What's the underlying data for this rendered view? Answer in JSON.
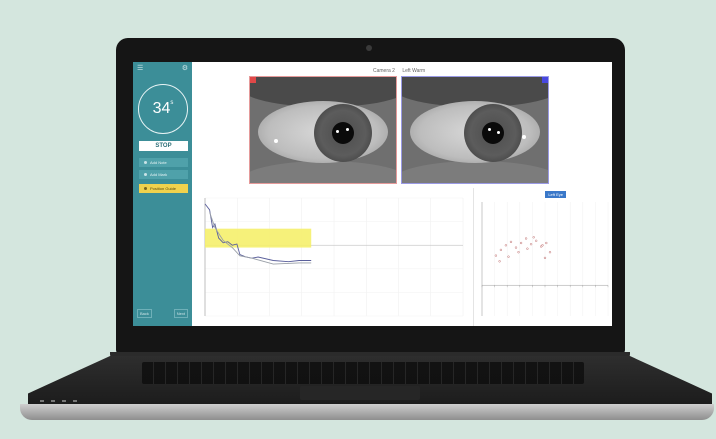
{
  "timer": {
    "value": "34",
    "unit": "s"
  },
  "sidebar": {
    "stop_label": "STOP",
    "buttons": [
      {
        "label": "Add Note",
        "active": false
      },
      {
        "label": "Add Mark",
        "active": false
      },
      {
        "label": "Position Guide",
        "active": true
      }
    ],
    "footer_left": "Back",
    "footer_right": "Next",
    "accent_color": "#3c8e98",
    "highlight_color": "#f0d24d"
  },
  "camera": {
    "camera_label": "Camera 2",
    "eye_label": "Left Warm"
  },
  "main_chart": {
    "title": "",
    "highlight_color": "#f5ef6b"
  },
  "scatter_chart": {
    "badge": "Left Eye",
    "corner_label": ""
  },
  "chart_data": [
    {
      "type": "line",
      "title": "",
      "highlight_band": {
        "y_from": 0.58,
        "y_to": 0.74,
        "x_from": 0,
        "x_to": 14
      },
      "ylim": [
        0,
        1
      ],
      "xlim": [
        0,
        34
      ],
      "series": [
        {
          "x": [
            0,
            0.6,
            1,
            1.3,
            1.8,
            2.4,
            3,
            3.6,
            4.2,
            4.6,
            5.4,
            6.2,
            7,
            9,
            11,
            12.4,
            14
          ],
          "values": [
            0.95,
            0.9,
            0.75,
            0.78,
            0.66,
            0.62,
            0.63,
            0.6,
            0.61,
            0.52,
            0.5,
            0.49,
            0.5,
            0.47,
            0.46,
            0.47,
            0.47
          ],
          "color": "#5a5f9b"
        },
        {
          "x": [
            0.6,
            1.3,
            2.4,
            3.6,
            4.6,
            6.2,
            9,
            12.4,
            14
          ],
          "values": [
            0.88,
            0.75,
            0.64,
            0.58,
            0.51,
            0.49,
            0.44,
            0.45,
            0.45
          ],
          "color": "#9aa0a8"
        }
      ]
    },
    {
      "type": "scatter",
      "title": "",
      "xlim": [
        0,
        10
      ],
      "ylim": [
        0,
        10
      ],
      "series": [
        {
          "x": [
            1.1,
            1.5,
            1.9,
            2.3,
            2.7,
            3.1,
            3.5,
            3.9,
            4.3,
            4.7,
            5.1,
            5.4,
            1.4,
            2.1,
            2.9,
            3.6,
            4.1,
            4.8,
            5.0
          ],
          "values": [
            5.3,
            5.8,
            6.2,
            6.5,
            6.0,
            6.4,
            6.8,
            6.3,
            6.6,
            6.1,
            6.4,
            5.6,
            4.8,
            5.2,
            5.6,
            5.9,
            6.9,
            6.2,
            5.1
          ],
          "color": "#c07070"
        }
      ]
    }
  ]
}
